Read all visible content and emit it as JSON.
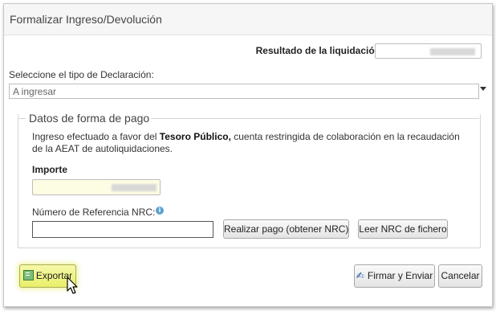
{
  "dialog": {
    "title": "Formalizar Ingreso/Devolución"
  },
  "result": {
    "label": "Resultado de la liquidación"
  },
  "declaration": {
    "label": "Seleccione el tipo de Declaración:",
    "selected": "A ingresar"
  },
  "payment": {
    "legend": "Datos de forma de pago",
    "info_prefix": "Ingreso efectuado a favor del",
    "info_bold": "Tesoro Público,",
    "info_suffix": "cuenta restringida de colaboración en la recaudación de la AEAT de autoliquidaciones.",
    "importe_label": "Importe",
    "nrc_label": "Número de Referencia  NRC:",
    "realizar_label": "Realizar pago (obtener NRC)",
    "leer_label": "Leer NRC de fichero"
  },
  "footer": {
    "exportar_label": "Exportar",
    "firmar_label": "Firmar y Enviar",
    "cancelar_label": "Cancelar"
  },
  "icons": {
    "info": "info-icon",
    "exportar": "spreadsheet-icon",
    "firmar": "sign-icon",
    "select_arrow": "chevron-down-icon",
    "cursor": "mouse-pointer-icon"
  }
}
